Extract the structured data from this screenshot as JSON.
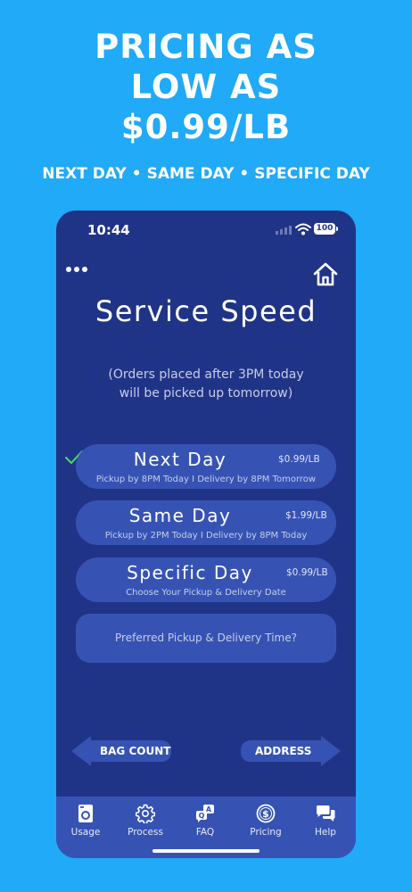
{
  "promo": {
    "headline_lines": [
      "PRICING AS",
      "LOW AS",
      "$0.99/LB"
    ],
    "subline": {
      "items": [
        "NEXT DAY",
        "SAME DAY",
        "SPECIFIC DAY"
      ],
      "separator": "•"
    }
  },
  "status_bar": {
    "time": "10:44",
    "battery": "100"
  },
  "screen": {
    "title": "Service Speed",
    "note_lines": [
      "(Orders placed after 3PM today",
      "will be picked up tomorrow)"
    ],
    "options": [
      {
        "name": "Next Day",
        "price": "$0.99/LB",
        "detail": "Pickup by 8PM Today I Delivery by 8PM Tomorrow",
        "selected": true
      },
      {
        "name": "Same Day",
        "price": "$1.99/LB",
        "detail": "Pickup by 2PM Today I Delivery by 8PM Today",
        "selected": false
      },
      {
        "name": "Specific Day",
        "price": "$0.99/LB",
        "detail": "Choose Your Pickup & Delivery Date",
        "selected": false
      }
    ],
    "time_preference": "Preferred Pickup & Delivery Time?",
    "nav": {
      "back_label": "BAG COUNT",
      "next_label": "ADDRESS"
    }
  },
  "tab_bar": {
    "tabs": [
      {
        "label": "Usage",
        "icon": "washing-machine-icon"
      },
      {
        "label": "Process",
        "icon": "gear-icon"
      },
      {
        "label": "FAQ",
        "icon": "qa-bubbles-icon"
      },
      {
        "label": "Pricing",
        "icon": "dollar-coin-icon"
      },
      {
        "label": "Help",
        "icon": "chat-bubbles-icon"
      }
    ]
  },
  "colors": {
    "background": "#20aaf7",
    "phone_background": "#203487",
    "button": "#3653b4",
    "check": "#4cd964"
  }
}
